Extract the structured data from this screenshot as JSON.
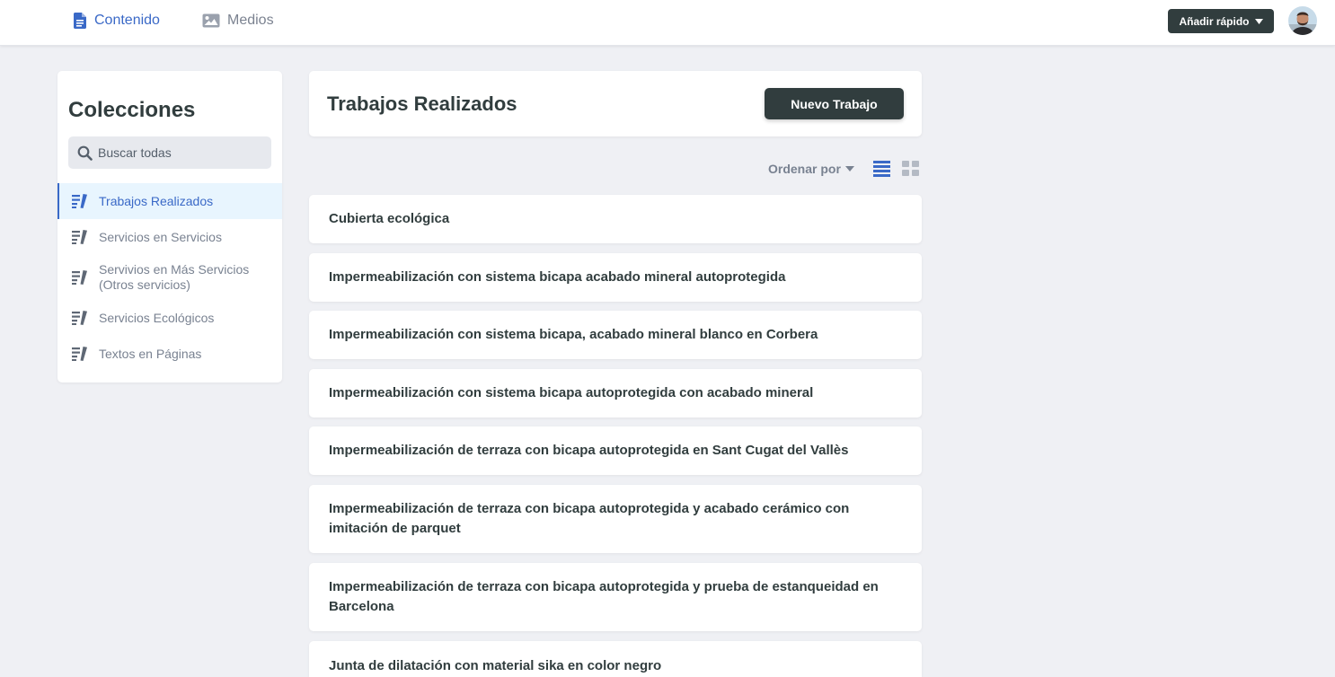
{
  "topbar": {
    "tabs": [
      {
        "label": "Contenido",
        "icon": "document-icon",
        "active": true
      },
      {
        "label": "Medios",
        "icon": "image-icon",
        "active": false
      }
    ],
    "quick_add_label": "Añadir rápido"
  },
  "sidebar": {
    "title": "Colecciones",
    "search_placeholder": "Buscar todas",
    "items": [
      {
        "label": "Trabajos Realizados",
        "icon": "collection-icon",
        "active": true
      },
      {
        "label": "Servicios en Servicios",
        "icon": "collection-icon"
      },
      {
        "label": "Servivios en Más Servicios (Otros servicios)",
        "icon": "collection-icon"
      },
      {
        "label": "Servicios Ecológicos",
        "icon": "collection-icon"
      },
      {
        "label": "Textos en Páginas",
        "icon": "collection-icon"
      }
    ]
  },
  "main": {
    "title": "Trabajos Realizados",
    "new_button": "Nuevo Trabajo",
    "sort_label": "Ordenar por",
    "view_mode": "list",
    "entries": [
      "Cubierta ecológica",
      "Impermeabilización con sistema bicapa acabado mineral autoprotegida",
      "Impermeabilización con sistema bicapa, acabado mineral blanco en Corbera",
      "Impermeabilización con sistema bicapa autoprotegida con acabado mineral",
      "Impermeabilización de terraza con bicapa autoprotegida en Sant Cugat del Vallès",
      "Impermeabilización de terraza con bicapa autoprotegida y acabado cerámico con imitación de parquet",
      "Impermeabilización de terraza con bicapa autoprotegida y prueba de estanqueidad en Barcelona",
      "Junta de dilatación con material sika en color negro"
    ]
  },
  "colors": {
    "accent": "#3a69c7",
    "dark": "#313d3e",
    "background": "#eff0f4",
    "active_item_bg": "#e8f5fe"
  }
}
